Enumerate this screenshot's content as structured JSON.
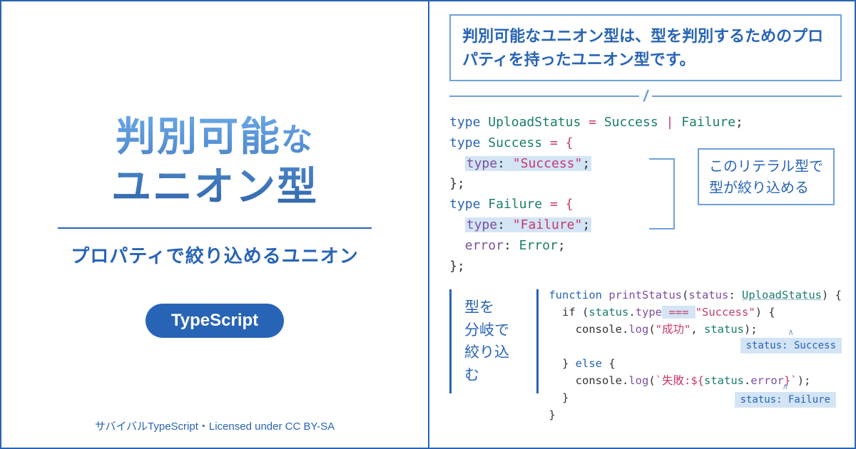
{
  "left": {
    "title_line1_main": "判別可能",
    "title_line1_small": "な",
    "title_line2": "ユニオン型",
    "subtitle": "プロパティで絞り込めるユニオン",
    "badge": "TypeScript",
    "license": "サバイバルTypeScript・Licensed under CC BY-SA"
  },
  "right": {
    "description": "判別可能なユニオン型は、型を判別するためのプロパティを持ったユニオン型です。",
    "annotation1_l1": "このリテラル型で",
    "annotation1_l2": "型が絞り込める",
    "annotation2_l1": "型を",
    "annotation2_l2": "分岐で",
    "annotation2_l3": "絞り込む",
    "tooltip1": "status: Success",
    "tooltip2": "status: Failure",
    "code1": {
      "l1_kw": "type ",
      "l1_name": "UploadStatus",
      "l1_eq": " = ",
      "l1_a": "Success",
      "l1_pipe": " | ",
      "l1_b": "Failure",
      "l1_end": ";",
      "l2_kw": "type ",
      "l2_name": "Success",
      "l2_eq": " = {",
      "l3_prop": "type",
      "l3_colon": ": ",
      "l3_val": "\"Success\"",
      "l3_end": ";",
      "l4": "};",
      "l5_kw": "type ",
      "l5_name": "Failure",
      "l5_eq": " = {",
      "l6_prop": "type",
      "l6_colon": ": ",
      "l6_val": "\"Failure\"",
      "l6_end": ";",
      "l7_prop": "error",
      "l7_colon": ": ",
      "l7_val": "Error",
      "l7_end": ";",
      "l8": "};"
    },
    "code2": {
      "l1_kw": "function ",
      "l1_fn": "printStatus",
      "l1_open": "(",
      "l1_param": "status",
      "l1_colon": ": ",
      "l1_type": "UploadStatus",
      "l1_close": ") {",
      "l2_a": "  if (",
      "l2_b": "status",
      "l2_c": ".",
      "l2_d": "type",
      "l2_e": " === ",
      "l2_f": "\"Success\"",
      "l2_g": ") {",
      "l3_a": "    console.",
      "l3_b": "log",
      "l3_c": "(",
      "l3_d": "\"成功\"",
      "l3_e": ", ",
      "l3_f": "status",
      "l3_g": ");",
      "l5_a": "  } ",
      "l5_b": "else",
      "l5_c": " {",
      "l6_a": "    console.",
      "l6_b": "log",
      "l6_c": "(",
      "l6_d": "`失敗:${",
      "l6_e": "status",
      "l6_f": ".",
      "l6_g": "error",
      "l6_h": "}`",
      "l6_i": ");",
      "l7": "  }",
      "l8": "}"
    }
  }
}
